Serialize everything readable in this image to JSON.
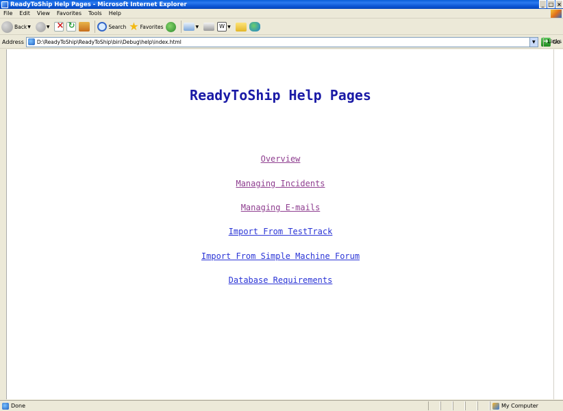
{
  "window": {
    "title": "ReadyToShip Help Pages - Microsoft Internet Explorer",
    "controls": [
      "_",
      "□",
      "×"
    ]
  },
  "menu": [
    "File",
    "Edit",
    "View",
    "Favorites",
    "Tools",
    "Help"
  ],
  "toolbar": {
    "back_label": "Back",
    "search_label": "Search",
    "favorites_label": "Favorites"
  },
  "address": {
    "label": "Address",
    "url": "D:\\ReadyToShip\\ReadyToShip\\bin\\Debug\\help\\index.html",
    "go_label": "Go",
    "links_label": "Links"
  },
  "page": {
    "heading": "ReadyToShip Help Pages",
    "links": [
      {
        "label": "Overview",
        "visited": true
      },
      {
        "label": "Managing Incidents",
        "visited": true
      },
      {
        "label": "Managing E-mails",
        "visited": true
      },
      {
        "label": "Import From TestTrack",
        "visited": false
      },
      {
        "label": "Import From Simple Machine Forum",
        "visited": false
      },
      {
        "label": "Database Requirements",
        "visited": false
      }
    ]
  },
  "status": {
    "text": "Done",
    "zone": "My Computer"
  },
  "colors": {
    "visited_link": "#8e3d8f",
    "unvisited_link": "#2a34d6",
    "heading": "#1a1aa6"
  }
}
